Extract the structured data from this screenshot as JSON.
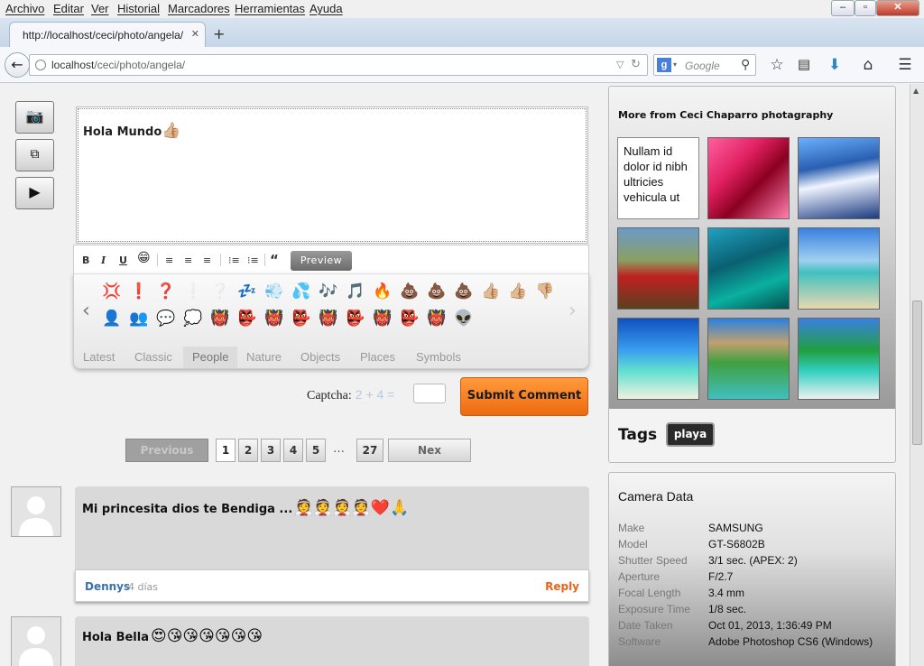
{
  "menu": [
    "Archivo",
    "Editar",
    "Ver",
    "Historial",
    "Marcadores",
    "Herramientas",
    "Ayuda"
  ],
  "tab": {
    "title": "http://localhost/ceci/photo/angela/",
    "new_tab": "+"
  },
  "address": {
    "host": "localhost",
    "path": "/ceci/photo/angela/"
  },
  "search": {
    "placeholder": "Google",
    "engine_letter": "g"
  },
  "editor": {
    "text": "Hola Mundo",
    "emoji": "👍🏼"
  },
  "toolbar": {
    "bold": "B",
    "italic": "I",
    "underline": "U",
    "quote": "“",
    "preview": "Preview"
  },
  "emoji_panel": {
    "row1": [
      "💢",
      "❗",
      "❓",
      "❕",
      "❔",
      "💤",
      "💨",
      "💦",
      "🎶",
      "🎵",
      "🔥",
      "💩",
      "💩",
      "💩",
      "👍🏼",
      "👍🏼",
      "👎🏼"
    ],
    "row2": [
      "👤",
      "👥",
      "💬",
      "💭",
      "👹",
      "👺",
      "👹",
      "👺",
      "👹",
      "👺",
      "👹",
      "👺",
      "👹",
      "👽"
    ],
    "tabs": [
      "Latest",
      "Classic",
      "People",
      "Nature",
      "Objects",
      "Places",
      "Symbols"
    ],
    "active_tab": "People"
  },
  "captcha": {
    "label": "Captcha:",
    "question": "2 + 4 =",
    "value": ""
  },
  "submit_label": "Submit Comment",
  "pagination": {
    "prev": "Previous",
    "pages": [
      "1",
      "2",
      "3",
      "4",
      "5"
    ],
    "ellipsis": "…",
    "last": "27",
    "next": "Nex",
    "current": "1"
  },
  "comments": [
    {
      "text": "Mi princesita dios te Bendiga ...",
      "emojis": "👰👰👰👰❤️🙏",
      "author": "Dennys",
      "time": "4 días",
      "reply": "Reply"
    },
    {
      "text": "Hola Bella",
      "emojis": "😍😘😘😘😘😘😘"
    }
  ],
  "gallery": {
    "title": "More from Ceci Chaparro photagraphy",
    "text_thumb": "Nullam id dolor id nibh ultricies vehicula ut"
  },
  "tags": {
    "label": "Tags",
    "items": [
      "playa"
    ]
  },
  "camera": {
    "title": "Camera Data",
    "rows": [
      {
        "k": "Make",
        "v": "SAMSUNG"
      },
      {
        "k": "Model",
        "v": "GT-S6802B"
      },
      {
        "k": "Shutter Speed",
        "v": "3/1 sec. (APEX: 2)"
      },
      {
        "k": "Aperture",
        "v": "F/2.7"
      },
      {
        "k": "Focal Length",
        "v": "3.4 mm"
      },
      {
        "k": "Exposure Time",
        "v": "1/8 sec."
      },
      {
        "k": "Date Taken",
        "v": "Oct 01, 2013, 1:36:49 PM"
      },
      {
        "k": "Software",
        "v": "Adobe Photoshop CS6 (Windows)"
      }
    ]
  },
  "colors": {
    "accent": "#ee6a10",
    "link": "#3a6fb0",
    "reply": "#e8651a"
  }
}
